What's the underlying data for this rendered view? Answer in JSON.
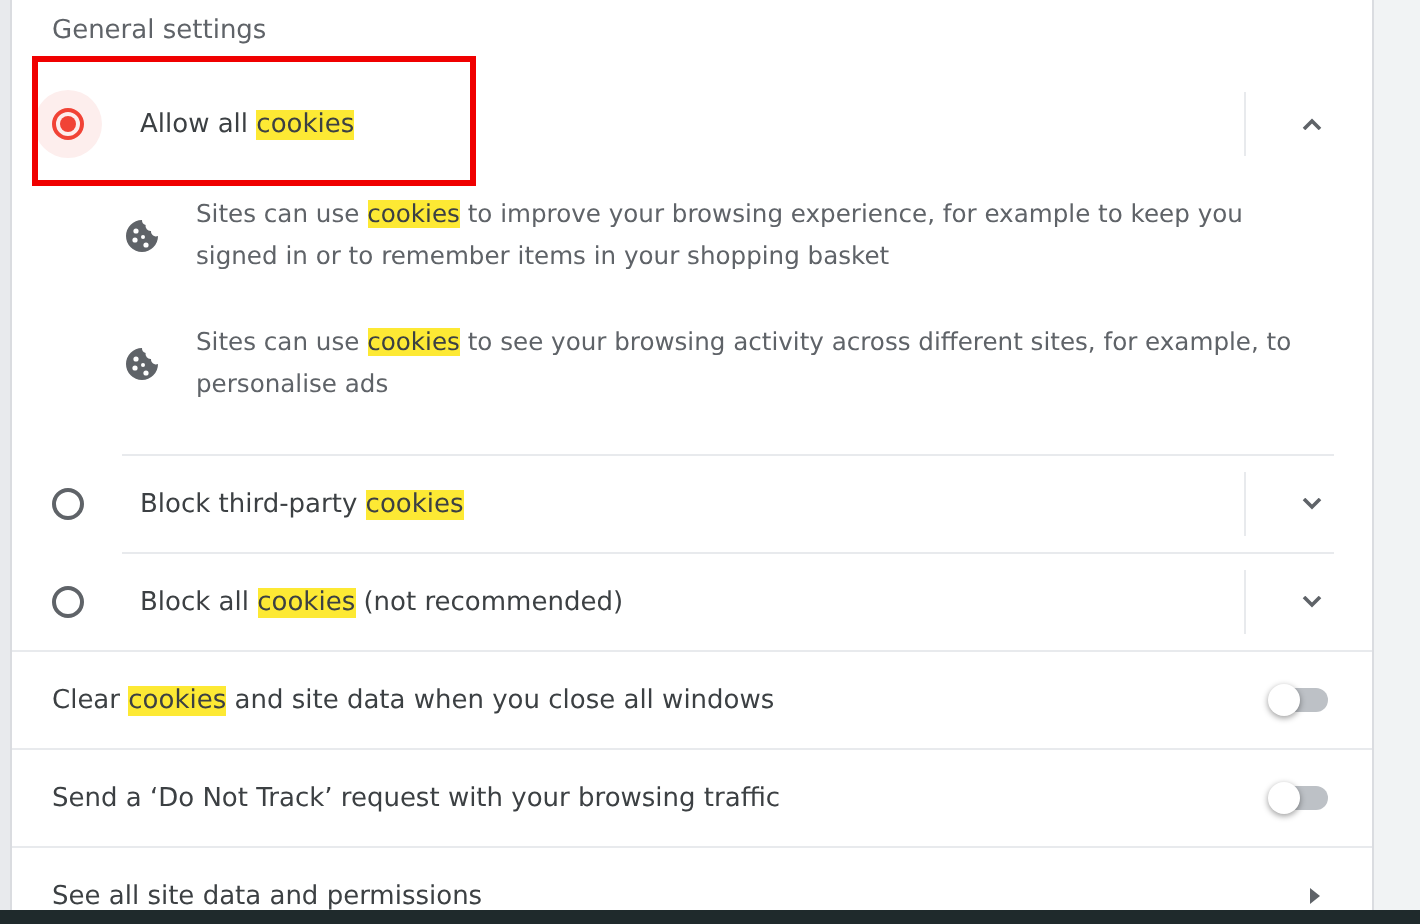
{
  "section_title": "General settings",
  "cookie_options": [
    {
      "label": "Allow all **cookies**",
      "selected": true,
      "expanded": true,
      "annotated": true,
      "details": [
        "Sites can use **cookies** to improve your browsing experience, for example to keep you signed in or to remember items in your shopping basket",
        "Sites can use **cookies** to see your browsing activity across different sites, for example, to personalise ads"
      ]
    },
    {
      "label": "Block third-party **cookies**",
      "selected": false,
      "expanded": false,
      "annotated": false
    },
    {
      "label": "Block all **cookies** (not recommended)",
      "selected": false,
      "expanded": false,
      "annotated": false
    }
  ],
  "toggles": [
    {
      "label": "Clear **cookies** and site data when you close all windows",
      "on": false
    },
    {
      "label": "Send a ‘Do Not Track’ request with your browsing traffic",
      "on": false
    }
  ],
  "link_row": {
    "label": "See all site data and permissions"
  }
}
